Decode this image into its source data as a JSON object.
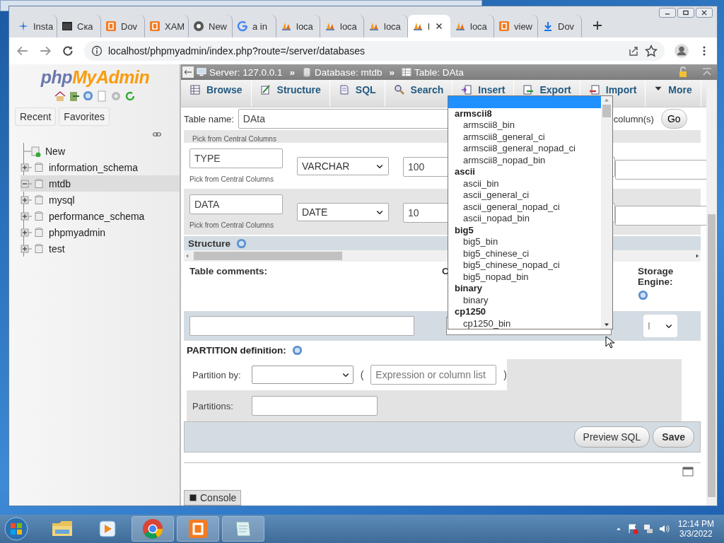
{
  "browser": {
    "tabs": [
      {
        "label": "Insta",
        "selected": false
      },
      {
        "label": "Ска",
        "selected": false
      },
      {
        "label": "Dov",
        "selected": false
      },
      {
        "label": "XAM",
        "selected": false
      },
      {
        "label": "New",
        "selected": false
      },
      {
        "label": "a in",
        "selected": false
      },
      {
        "label": "loca",
        "selected": false
      },
      {
        "label": "loca",
        "selected": false
      },
      {
        "label": "loca",
        "selected": false
      },
      {
        "label": "l",
        "selected": true
      },
      {
        "label": "loca",
        "selected": false
      },
      {
        "label": "view",
        "selected": false
      },
      {
        "label": "Dov",
        "selected": false
      }
    ],
    "address": "localhost/phpmyadmin/index.php?route=/server/databases"
  },
  "sidebar": {
    "logo": [
      "php",
      "MyAdmin"
    ],
    "buttons": [
      "Recent",
      "Favorites"
    ],
    "tree": [
      {
        "label": "New",
        "kind": "new"
      },
      {
        "label": "information_schema",
        "kind": "db",
        "expanded": false,
        "selected": false
      },
      {
        "label": "mtdb",
        "kind": "db",
        "expanded": true,
        "selected": true
      },
      {
        "label": "mysql",
        "kind": "db",
        "expanded": false,
        "selected": false
      },
      {
        "label": "performance_schema",
        "kind": "db",
        "expanded": false,
        "selected": false
      },
      {
        "label": "phpmyadmin",
        "kind": "db",
        "expanded": false,
        "selected": false
      },
      {
        "label": "test",
        "kind": "db",
        "expanded": false,
        "selected": false
      }
    ]
  },
  "breadcrumb": [
    {
      "label": "Server: 127.0.0.1"
    },
    {
      "prefix": "»",
      "label": "Database: mtdb"
    },
    {
      "prefix": "»",
      "label": "Table: DAta"
    }
  ],
  "nav_tabs": [
    "Browse",
    "Structure",
    "SQL",
    "Search",
    "Insert",
    "Export",
    "Import",
    "More"
  ],
  "form": {
    "table_name_label": "Table name:",
    "table_name": "DAta",
    "columns_label": "column(s)",
    "go": "Go",
    "cut_hint": "Pick from Central Columns",
    "columns": [
      {
        "name": "TYPE",
        "type": "VARCHAR",
        "length": "100",
        "hint": "Pick from Central Columns"
      },
      {
        "name": "DATA",
        "type": "DATE",
        "length": "10",
        "hint": "Pick from Central Columns"
      }
    ],
    "structure_heading": "Structure",
    "table_comments_label": "Table comments:",
    "collation_label": "C",
    "storage_engine_label": "Storage Engine:",
    "storage_engine": "I",
    "partition_heading": "PARTITION definition:",
    "partition_by_label": "Partition by:",
    "open_paren": "(",
    "expression_placeholder": "Expression or column list",
    "close_paren": ")",
    "partitions_label": "Partitions:",
    "buttons": [
      "Preview SQL",
      "Save"
    ],
    "console": "Console"
  },
  "collation_dropdown": [
    {
      "kind": "blank",
      "selected": true
    },
    {
      "kind": "group",
      "label": "armscii8"
    },
    {
      "kind": "option",
      "label": "armscii8_bin",
      "selected": false
    },
    {
      "kind": "option",
      "label": "armscii8_general_ci",
      "selected": false
    },
    {
      "kind": "option",
      "label": "armscii8_general_nopad_ci",
      "selected": false
    },
    {
      "kind": "option",
      "label": "armscii8_nopad_bin",
      "selected": false
    },
    {
      "kind": "group",
      "label": "ascii"
    },
    {
      "kind": "option",
      "label": "ascii_bin",
      "selected": false
    },
    {
      "kind": "option",
      "label": "ascii_general_ci",
      "selected": false
    },
    {
      "kind": "option",
      "label": "ascii_general_nopad_ci",
      "selected": false
    },
    {
      "kind": "option",
      "label": "ascii_nopad_bin",
      "selected": false
    },
    {
      "kind": "group",
      "label": "big5"
    },
    {
      "kind": "option",
      "label": "big5_bin",
      "selected": false
    },
    {
      "kind": "option",
      "label": "big5_chinese_ci",
      "selected": false
    },
    {
      "kind": "option",
      "label": "big5_chinese_nopad_ci",
      "selected": false
    },
    {
      "kind": "option",
      "label": "big5_nopad_bin",
      "selected": false
    },
    {
      "kind": "group",
      "label": "binary"
    },
    {
      "kind": "option",
      "label": "binary",
      "selected": false
    },
    {
      "kind": "group",
      "label": "cp1250"
    },
    {
      "kind": "option",
      "label": "cp1250_bin",
      "selected": false
    }
  ],
  "taskbar": {
    "apps": [
      {
        "open": false
      },
      {
        "open": false
      },
      {
        "open": true
      },
      {
        "open": true
      },
      {
        "open": true
      }
    ],
    "time": "12:14 PM",
    "date": "3/3/2022"
  }
}
